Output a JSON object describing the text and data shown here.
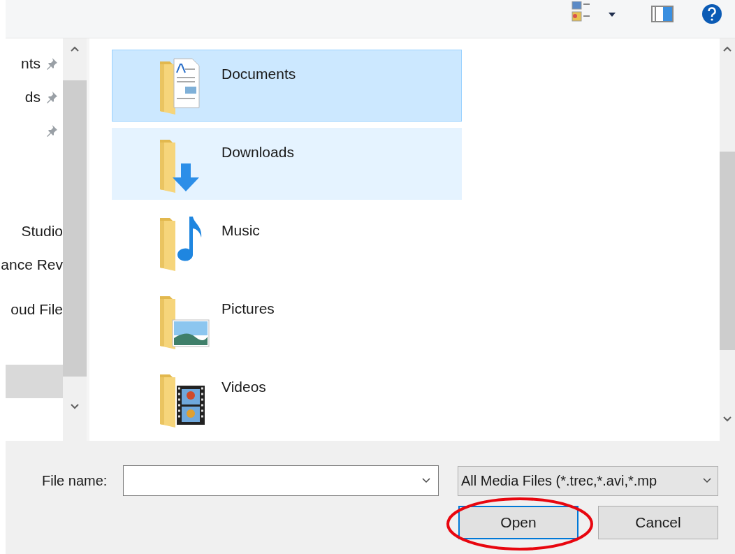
{
  "toolbar": {
    "items": [
      {
        "kind": "view"
      },
      {
        "kind": "caret"
      },
      {
        "kind": "preview"
      },
      {
        "kind": "help"
      }
    ]
  },
  "sidebar": {
    "items": [
      {
        "label": "nts",
        "pinned": true,
        "selected": false
      },
      {
        "label": "ds",
        "pinned": true,
        "selected": false
      },
      {
        "pinned": true,
        "selected": false
      },
      {
        "label": "Studio",
        "pinned": false,
        "selected": false
      },
      {
        "label": "ance Rev",
        "pinned": false,
        "selected": false
      },
      {
        "label": "oud File",
        "pinned": false,
        "selected": false
      },
      {
        "pinned": false,
        "selected": true
      }
    ]
  },
  "folders": [
    {
      "name": "Documents",
      "kind": "documents",
      "selected": true,
      "hovered": false
    },
    {
      "name": "Downloads",
      "kind": "downloads",
      "selected": false,
      "hovered": true
    },
    {
      "name": "Music",
      "kind": "music",
      "selected": false,
      "hovered": false
    },
    {
      "name": "Pictures",
      "kind": "pictures",
      "selected": false,
      "hovered": false
    },
    {
      "name": "Videos",
      "kind": "videos",
      "selected": false,
      "hovered": false
    }
  ],
  "file_name": {
    "label": "File name:"
  },
  "file_type": {
    "value": "All Media Files (*.trec,*.avi,*.mp"
  },
  "buttons": [
    {
      "label": "Open",
      "default": true,
      "circled": true
    },
    {
      "label": "Cancel",
      "default": false,
      "circled": false
    }
  ]
}
